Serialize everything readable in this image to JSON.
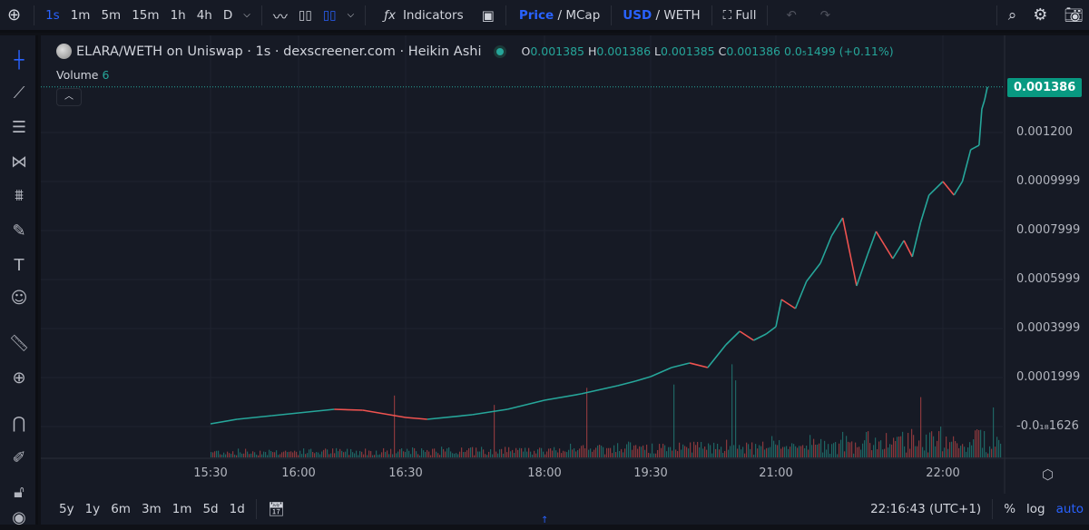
{
  "toolbar": {
    "intervals": [
      "1s",
      "1m",
      "5m",
      "15m",
      "1h",
      "4h",
      "D"
    ],
    "active_interval": "1s",
    "indicators_label": "Indicators",
    "price_label": "Price",
    "mcap_label": "MCap",
    "usd_label": "USD",
    "weth_label": "WETH",
    "full_label": "Full",
    "slash": "/"
  },
  "legend": {
    "title": "ELARA/WETH on Uniswap · 1s · dexscreener.com · Heikin Ashi",
    "o_label": "O",
    "o": "0.001385",
    "h_label": "H",
    "h": "0.001386",
    "l_label": "L",
    "l": "0.001385",
    "c_label": "C",
    "c": "0.001386",
    "change": "0.0₅1499 (+0.11%)",
    "volume_label": "Volume",
    "volume_value": "6"
  },
  "colors": {
    "up": "#26a69a",
    "down": "#ef5350",
    "accent": "#2962ff",
    "last_price_bg": "#089981"
  },
  "left_tools": [
    "crosshair-icon",
    "trend-line-icon",
    "fib-icon",
    "pattern-icon",
    "prediction-icon",
    "brush-icon",
    "text-icon",
    "emoji-icon",
    "ruler-icon",
    "zoom-in-icon",
    "magnet-icon",
    "lock-pencil-icon",
    "lock-icon",
    "eye-icon"
  ],
  "bottom": {
    "ranges": [
      "5y",
      "1y",
      "6m",
      "3m",
      "1m",
      "5d",
      "1d"
    ],
    "time": "22:16:43 (UTC+1)",
    "percent": "%",
    "log": "log",
    "auto": "auto"
  },
  "chart_data": {
    "type": "line",
    "style": "Heikin Ashi",
    "last_price": "0.001386",
    "y_ticks": [
      "0.001200",
      "0.0009999",
      "0.0007999",
      "0.0005999",
      "0.0003999",
      "0.0001999",
      "-0.0₁₈1626"
    ],
    "x_ticks": [
      "15:30",
      "16:00",
      "16:30",
      "18:00",
      "19:30",
      "21:00",
      "22:00"
    ],
    "grid": true,
    "series": [
      {
        "points": [
          [
            "15:30",
            1.11e-05
          ],
          [
            "15:39",
            2.96e-05
          ],
          [
            "15:51",
            4.44e-05
          ],
          [
            "16:00",
            5.56e-05
          ],
          [
            "16:10",
            7.04e-05
          ],
          [
            "16:18",
            6.67e-05
          ],
          [
            "16:30",
            3.7e-05
          ],
          [
            "16:44",
            2.96e-05
          ],
          [
            "17:13",
            4.81e-05
          ],
          [
            "17:36",
            7.04e-05
          ],
          [
            "18:00",
            0.0001074
          ],
          [
            "18:31",
            0.0001333
          ],
          [
            "19:02",
            0.0001667
          ],
          [
            "19:17",
            0.0001852
          ],
          [
            "19:30",
            0.0002037
          ],
          [
            "19:45",
            0.0002407
          ],
          [
            "19:58",
            0.0002593
          ],
          [
            "20:11",
            0.0002407
          ],
          [
            "20:24",
            0.0003333
          ],
          [
            "20:34",
            0.0003889
          ],
          [
            "20:44",
            0.0003519
          ],
          [
            "20:53",
            0.0003778
          ],
          [
            "21:00",
            0.0004074
          ],
          [
            "21:02",
            0.0005185
          ],
          [
            "21:07",
            0.0004815
          ],
          [
            "21:11",
            0.0005926
          ],
          [
            "21:16",
            0.0006667
          ],
          [
            "21:20",
            0.0007778
          ],
          [
            "21:24",
            0.0008519
          ],
          [
            "21:27",
            0.0006852
          ],
          [
            "21:29",
            0.0005741
          ],
          [
            "21:33",
            0.0007037
          ],
          [
            "21:36",
            0.0007963
          ],
          [
            "21:39",
            0.0007407
          ],
          [
            "21:42",
            0.0006852
          ],
          [
            "21:46",
            0.0007593
          ],
          [
            "21:49",
            0.0006926
          ],
          [
            "21:52",
            0.0008333
          ],
          [
            "21:55",
            0.0009444
          ],
          [
            "22:00",
            0.001
          ],
          [
            "22:04",
            0.0009444
          ],
          [
            "22:07",
            0.001
          ],
          [
            "22:10",
            0.00113
          ],
          [
            "22:13",
            0.001148
          ],
          [
            "22:14",
            0.001296
          ],
          [
            "22:15",
            0.001333
          ],
          [
            "22:16",
            0.001386
          ]
        ]
      }
    ]
  }
}
